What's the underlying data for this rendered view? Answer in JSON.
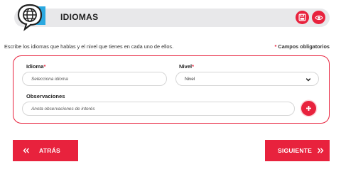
{
  "header": {
    "title": "IDIOMAS",
    "icon": "globe-speech-bubble-icon",
    "save_icon": "save-icon",
    "view_icon": "eye-icon"
  },
  "intro": {
    "text": "Escribe los idiomas que hablas y el nivel que tienes en cada uno de ellos.",
    "required_star": "*",
    "required_text": "Campos obligatorios"
  },
  "form": {
    "idioma_label": "Idioma",
    "idioma_star": "*",
    "idioma_placeholder": "Selecciona idioma",
    "nivel_label": "Nivel",
    "nivel_star": "*",
    "nivel_value": "Nivel",
    "observaciones_label": "Observaciones",
    "observaciones_placeholder": "Anota observaciones de interés",
    "add_icon": "plus-icon"
  },
  "nav": {
    "back_label": "ATRÁS",
    "back_icon": "double-chevron-left-icon",
    "next_label": "SIGUIENTE",
    "next_icon": "double-chevron-right-icon"
  },
  "colors": {
    "accent": "#e8223d",
    "header_bg": "#e8e8ea",
    "icon_blue": "#2aa8e0"
  }
}
